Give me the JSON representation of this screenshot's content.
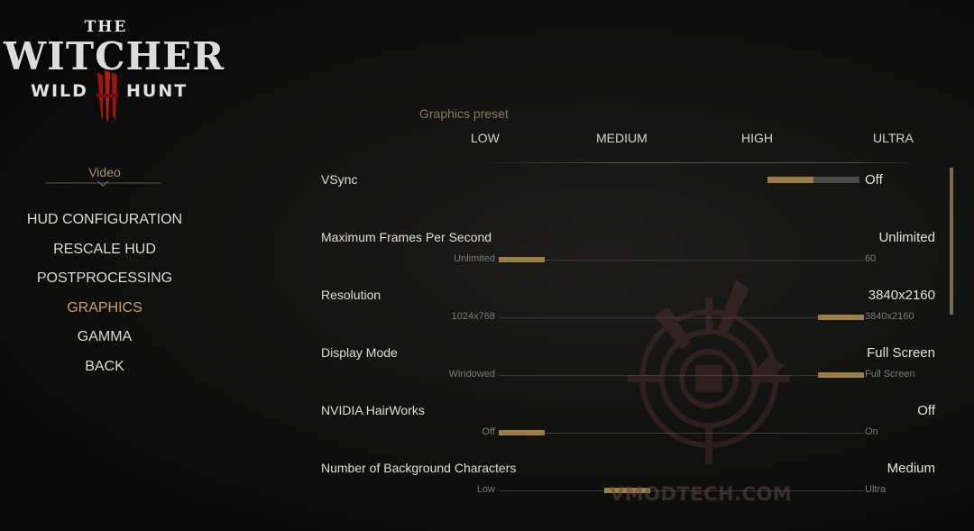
{
  "logo": {
    "the": "THE",
    "witcher": "WITCHER",
    "wild": "WILD",
    "hunt": "HUNT",
    "numeral": "III"
  },
  "sidebar": {
    "section_title": "Video",
    "items": [
      {
        "label": "HUD CONFIGURATION",
        "active": false
      },
      {
        "label": "RESCALE HUD",
        "active": false
      },
      {
        "label": "POSTPROCESSING",
        "active": false
      },
      {
        "label": "GRAPHICS",
        "active": true
      },
      {
        "label": "GAMMA",
        "active": false
      },
      {
        "label": "BACK",
        "active": false
      }
    ]
  },
  "preset": {
    "title": "Graphics preset",
    "options": [
      "LOW",
      "MEDIUM",
      "HIGH",
      "ULTRA"
    ]
  },
  "settings": {
    "vsync": {
      "label": "VSync",
      "value": "Off",
      "level": 0.5
    },
    "max_fps": {
      "label": "Maximum Frames Per Second",
      "value": "Unlimited",
      "min": "Unlimited",
      "max": "60",
      "level": 0.0
    },
    "resolution": {
      "label": "Resolution",
      "value": "3840x2160",
      "min": "1024x768",
      "max": "3840x2160",
      "level": 1.0
    },
    "display_mode": {
      "label": "Display Mode",
      "value": "Full Screen",
      "min": "Windowed",
      "max": "Full Screen",
      "level": 1.0
    },
    "hairworks": {
      "label": "NVIDIA HairWorks",
      "value": "Off",
      "min": "Off",
      "max": "On",
      "level": 0.0
    },
    "bg_characters": {
      "label": "Number of Background Characters",
      "value": "Medium",
      "min": "Low",
      "max": "Ultra",
      "level": 0.33
    }
  },
  "watermark": {
    "text": "VMODTECH.COM"
  },
  "colors": {
    "accent": "#9b7e45",
    "active_text": "#c9a45e",
    "background": "#0b0b0b"
  }
}
